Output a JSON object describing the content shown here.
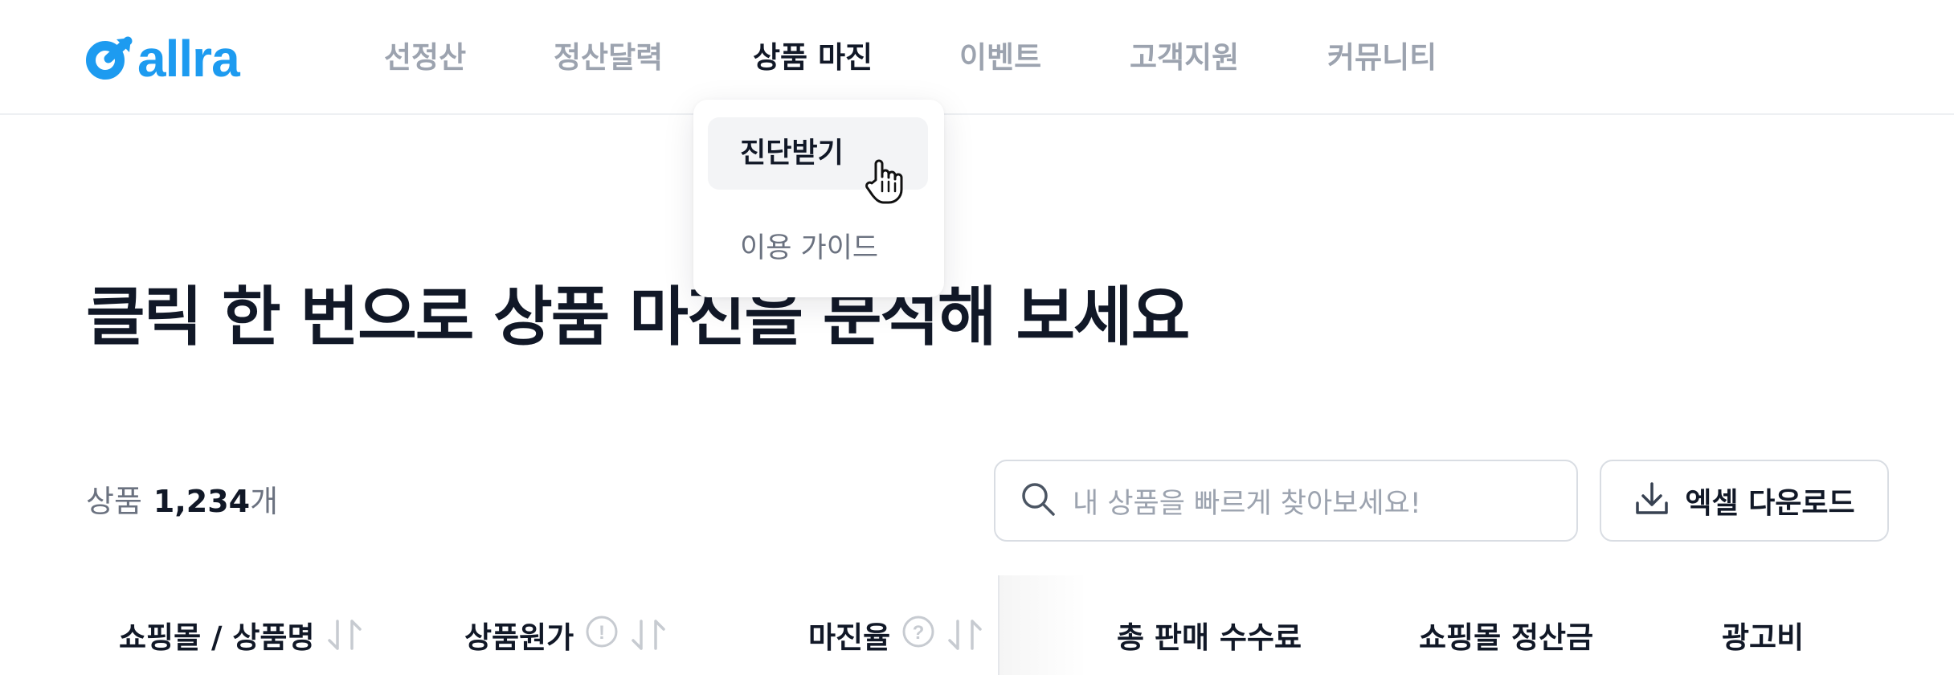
{
  "brand": {
    "name": "allra",
    "color": "#1d9bf0"
  },
  "nav": {
    "items": [
      {
        "label": "선정산",
        "active": false
      },
      {
        "label": "정산달력",
        "active": false
      },
      {
        "label": "상품 마진",
        "active": true
      },
      {
        "label": "이벤트",
        "active": false
      },
      {
        "label": "고객지원",
        "active": false
      },
      {
        "label": "커뮤니티",
        "active": false
      }
    ]
  },
  "dropdown": {
    "items": [
      {
        "label": "진단받기",
        "hovered": true
      },
      {
        "label": "이용 가이드",
        "hovered": false
      }
    ]
  },
  "hero": {
    "title": "클릭 한 번으로 상품 마진을 분석해 보세요"
  },
  "toolbar": {
    "count_label": "상품",
    "count_value": "1,234",
    "count_unit": "개",
    "search_placeholder": "내 상품을 빠르게 찾아보세요!",
    "excel_label": "엑셀 다운로드"
  },
  "table": {
    "columns": [
      {
        "label": "쇼핑몰 / 상품명",
        "sortable": true,
        "info": false
      },
      {
        "label": "상품원가",
        "sortable": true,
        "info": true,
        "info_symbol": "!"
      },
      {
        "label": "마진율",
        "sortable": true,
        "info": true,
        "info_symbol": "?"
      },
      {
        "label": "총 판매 수수료",
        "sortable": false,
        "info": false
      },
      {
        "label": "쇼핑몰 정산금",
        "sortable": false,
        "info": false
      },
      {
        "label": "광고비",
        "sortable": false,
        "info": false
      }
    ]
  },
  "icons": {
    "logo": "allra-logo-icon",
    "search": "search-icon",
    "download": "download-icon",
    "sort": "sort-arrows-icon",
    "info": "info-circle-icon",
    "cursor": "hand-pointer-icon"
  },
  "colors": {
    "accent": "#1d9bf0",
    "text": "#111827",
    "muted": "#9ca3af"
  }
}
